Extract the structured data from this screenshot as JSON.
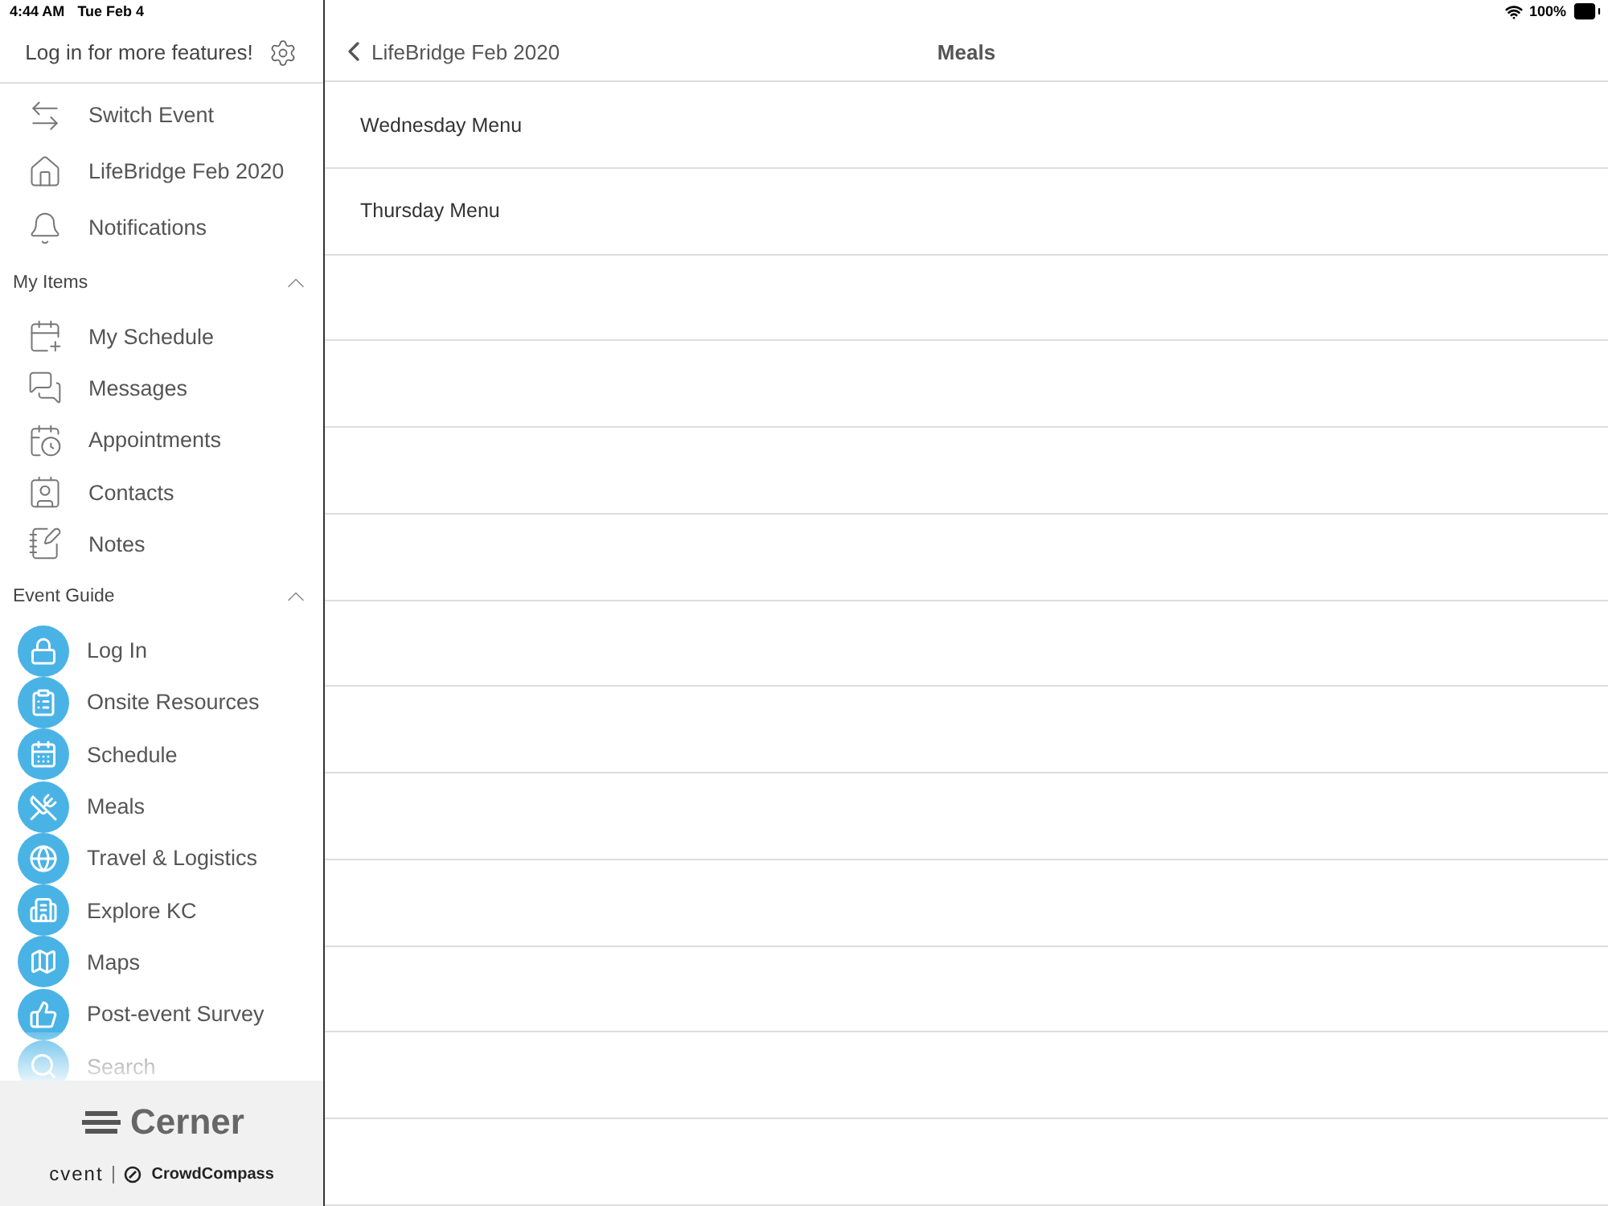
{
  "status_bar": {
    "time": "4:44 AM",
    "date": "Tue Feb 4",
    "battery": "100%"
  },
  "sidebar": {
    "header": "Log in for more features!",
    "top_items": [
      {
        "label": "Switch Event"
      },
      {
        "label": "LifeBridge Feb 2020"
      },
      {
        "label": "Notifications"
      }
    ],
    "sections": [
      {
        "title": "My Items",
        "expanded": true,
        "kind": "line",
        "items": [
          {
            "label": "My Schedule"
          },
          {
            "label": "Messages"
          },
          {
            "label": "Appointments"
          },
          {
            "label": "Contacts"
          },
          {
            "label": "Notes"
          }
        ]
      },
      {
        "title": "Event Guide",
        "expanded": true,
        "kind": "circle",
        "items": [
          {
            "label": "Log In"
          },
          {
            "label": "Onsite Resources"
          },
          {
            "label": "Schedule"
          },
          {
            "label": "Meals"
          },
          {
            "label": "Travel & Logistics"
          },
          {
            "label": "Explore KC"
          },
          {
            "label": "Maps"
          },
          {
            "label": "Post-event Survey"
          },
          {
            "label": "Search"
          }
        ]
      }
    ],
    "footer": {
      "brand": "Cerner",
      "partner": "cvent",
      "product": "CrowdCompass"
    }
  },
  "nav": {
    "back": "LifeBridge Feb 2020",
    "title": "Meals"
  },
  "rows": [
    {
      "label": "Wednesday Menu"
    },
    {
      "label": "Thursday Menu"
    }
  ]
}
